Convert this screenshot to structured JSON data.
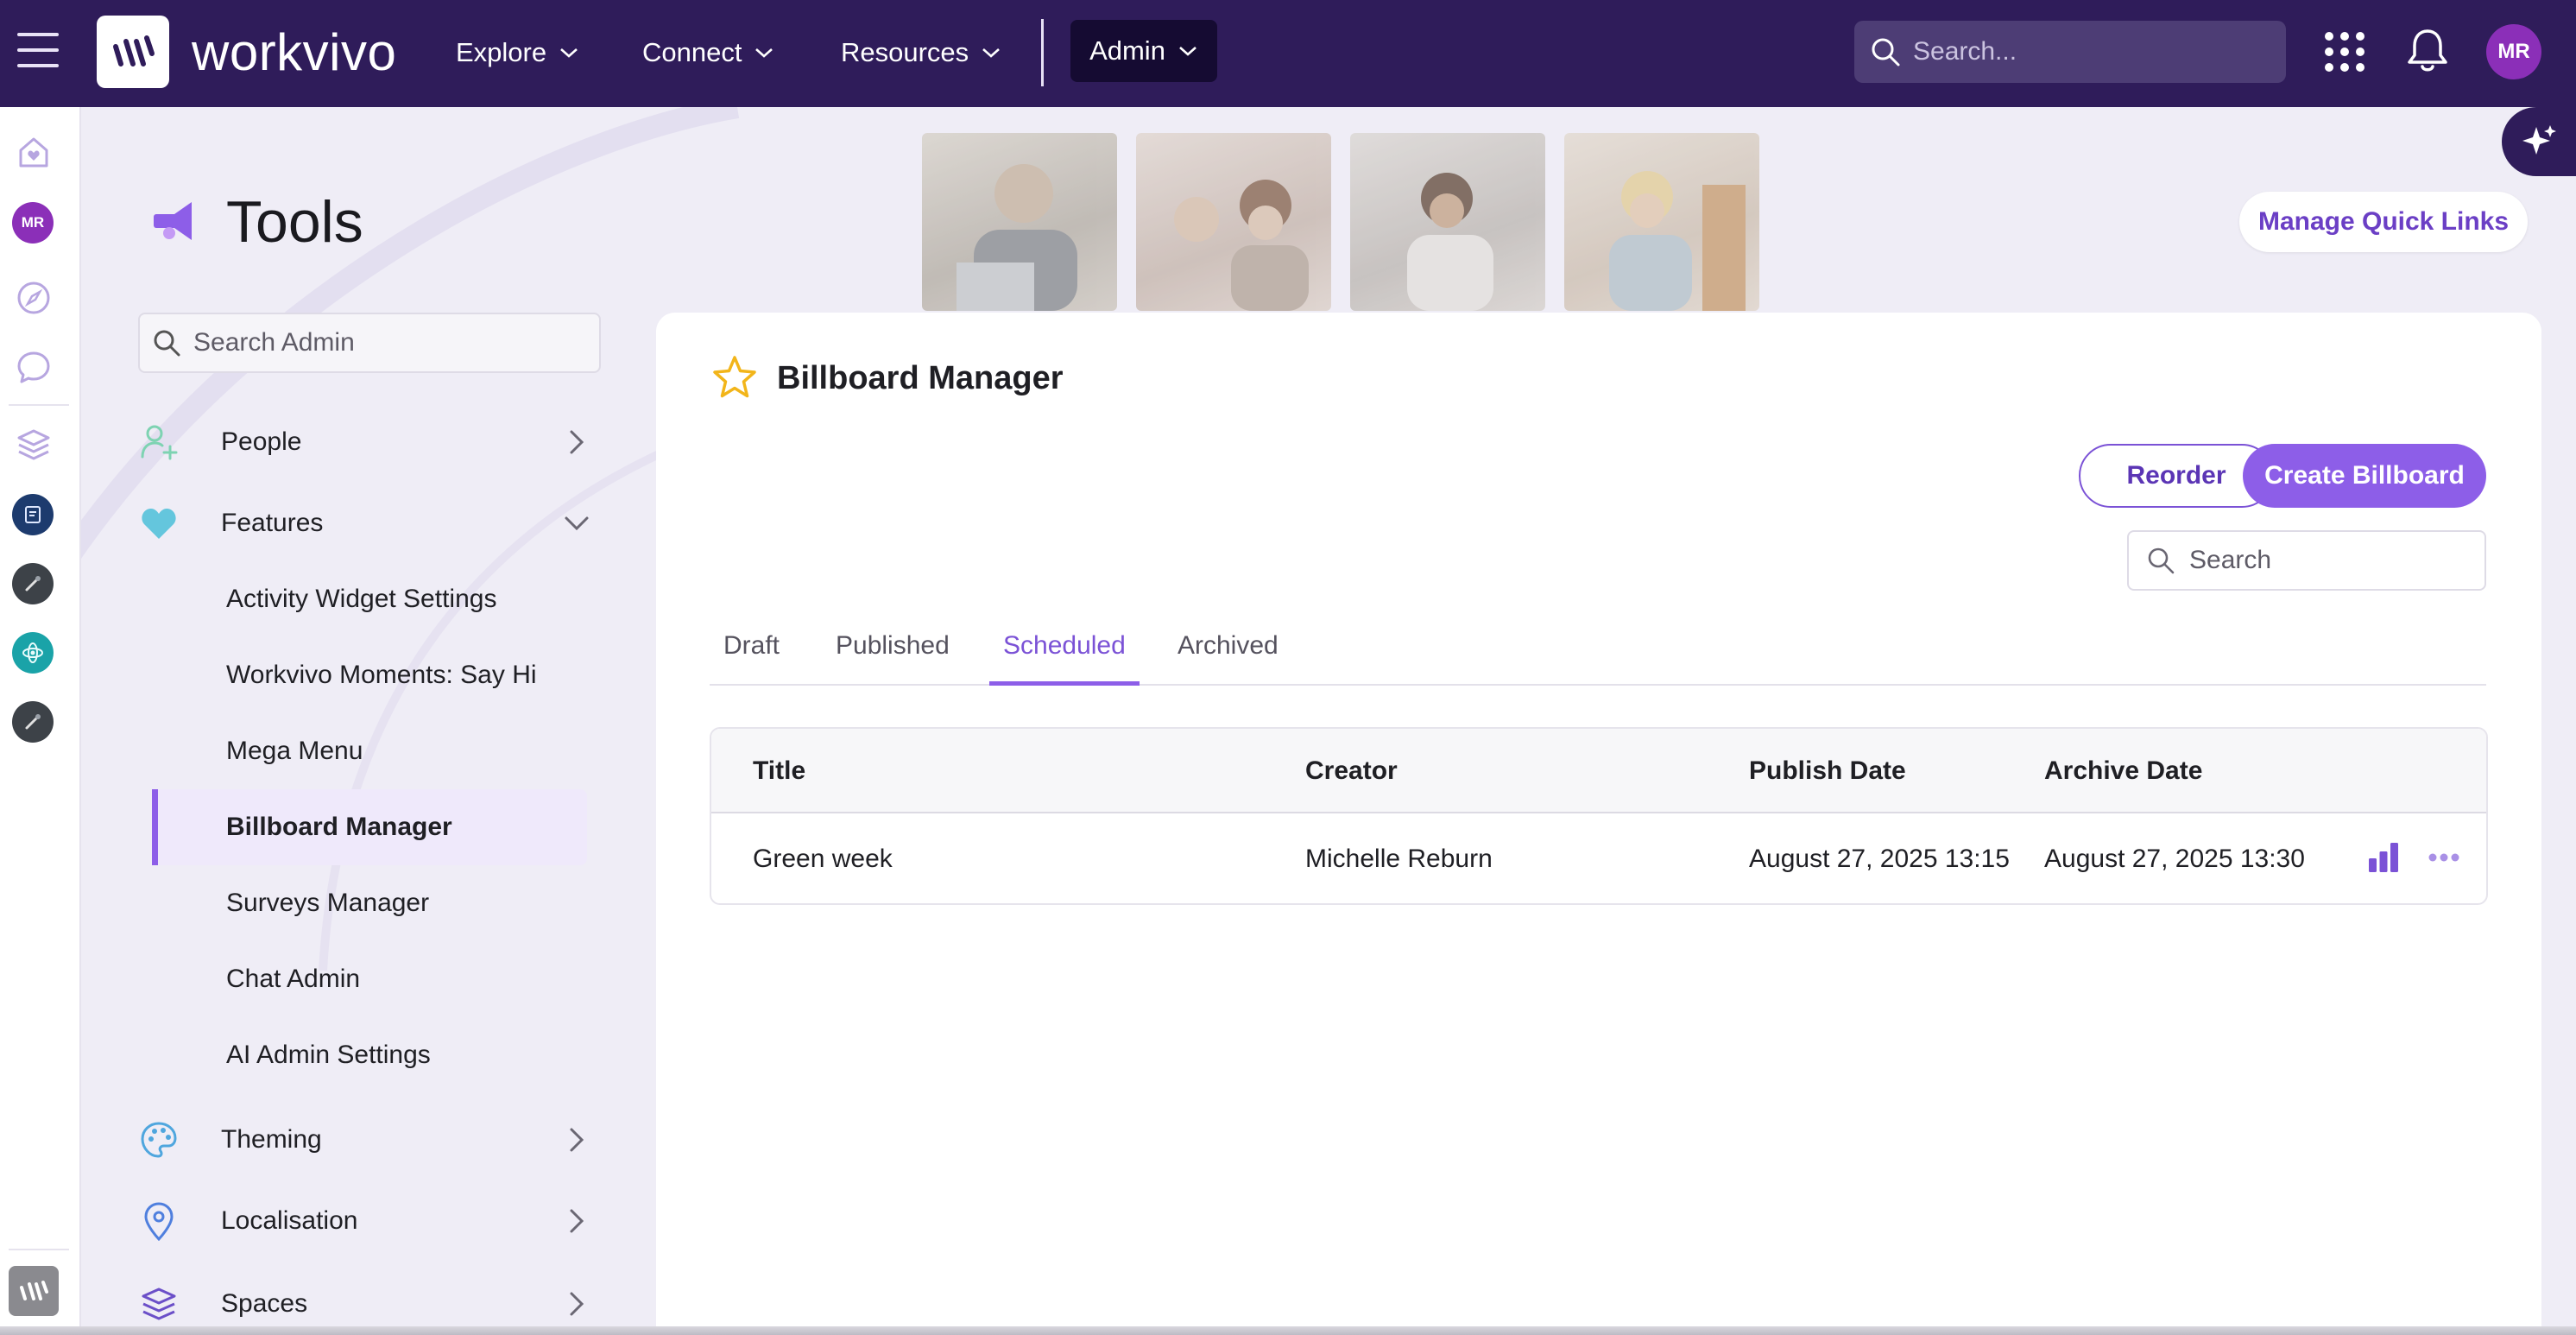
{
  "topbar": {
    "brand": "workvivo",
    "nav": [
      {
        "label": "Explore"
      },
      {
        "label": "Connect"
      },
      {
        "label": "Resources"
      }
    ],
    "admin_label": "Admin",
    "search_placeholder": "Search...",
    "avatar_initials": "MR"
  },
  "rail": {
    "avatar_initials": "MR",
    "icons": [
      "home-heart-icon",
      "compass-icon",
      "chat-bubble-icon",
      "layers-icon",
      "space-avatar-icon",
      "tools-avatar-icon",
      "atom-avatar-icon",
      "tools-avatar-icon",
      "workvivo-logo-icon"
    ]
  },
  "page": {
    "title": "Tools",
    "quick_links_label": "Manage Quick Links"
  },
  "admin_nav": {
    "search_placeholder": "Search Admin",
    "sections": {
      "people": "People",
      "features": "Features",
      "theming": "Theming",
      "localisation": "Localisation",
      "spaces": "Spaces"
    },
    "feature_items": [
      "Activity Widget Settings",
      "Workvivo Moments: Say Hi",
      "Mega Menu",
      "Billboard Manager",
      "Surveys Manager",
      "Chat Admin",
      "AI Admin Settings"
    ],
    "active_item": "Billboard Manager"
  },
  "billboard": {
    "title": "Billboard Manager",
    "reorder_label": "Reorder",
    "create_label": "Create Billboard",
    "search_placeholder": "Search",
    "tabs": [
      "Draft",
      "Published",
      "Scheduled",
      "Archived"
    ],
    "active_tab": "Scheduled",
    "columns": [
      "Title",
      "Creator",
      "Publish Date",
      "Archive Date"
    ],
    "rows": [
      {
        "title": "Green week",
        "creator": "Michelle Reburn",
        "publish_date": "August 27, 2025 13:15",
        "archive_date": "August 27, 2025 13:30"
      }
    ]
  },
  "colors": {
    "topbar": "#2f1c5a",
    "accent": "#8d5ee8",
    "accent_text": "#7b52d6",
    "active_item_bg": "#efe9fb"
  }
}
